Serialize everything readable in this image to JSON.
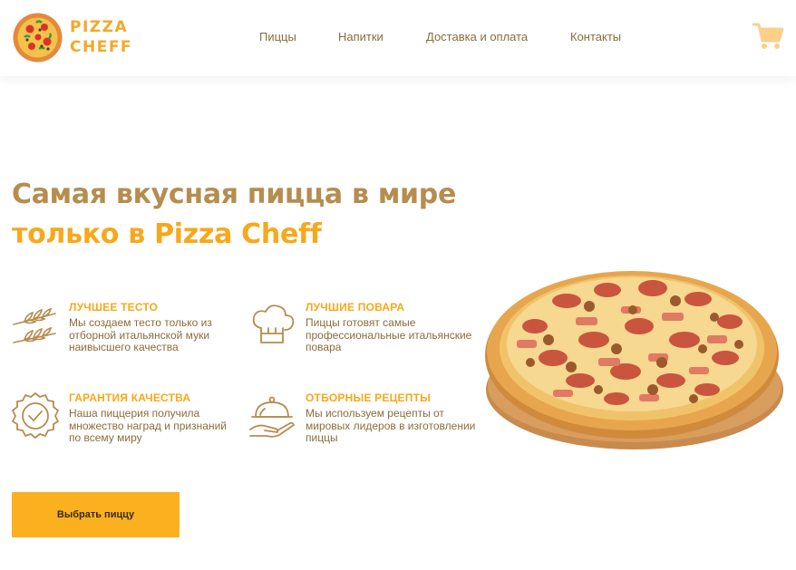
{
  "header": {
    "logo": {
      "line1": "PIZZA",
      "line2": "CHEFF"
    },
    "nav": [
      "Пиццы",
      "Напитки",
      "Доставка и оплата",
      "Контакты"
    ],
    "cart_icon": "cart-icon"
  },
  "hero": {
    "title_line1": "Самая вкусная пицца в мире",
    "title_line2": "только в Pizza Cheff",
    "features": [
      {
        "icon": "wheat-icon",
        "title": "ЛУЧШЕЕ ТЕСТО",
        "text": "Мы создаем тесто только из отборной итальянской муки наивысшего качества"
      },
      {
        "icon": "chef-hat-icon",
        "title": "ЛУЧШИЕ ПОВАРА",
        "text": "Пиццы готовят самые профессиональные итальянские повара"
      },
      {
        "icon": "quality-badge-icon",
        "title": "ГАРАНТИЯ КАЧЕСТВА",
        "text": "Наша пиццерия получила множество наград и признаний по всему миру"
      },
      {
        "icon": "serving-cloche-icon",
        "title": "ОТБОРНЫЕ РЕЦЕПТЫ",
        "text": "Мы используем рецепты от мировых лидеров в изготовлении пиццы"
      }
    ],
    "cta_label": "Выбрать пиццу",
    "image": "pizza-image"
  },
  "colors": {
    "accent": "#f7a81b",
    "brand_brown": "#b58d4e",
    "text_brown": "#8a6d3b",
    "button": "#fbb11f",
    "cart": "#fbd08a"
  }
}
